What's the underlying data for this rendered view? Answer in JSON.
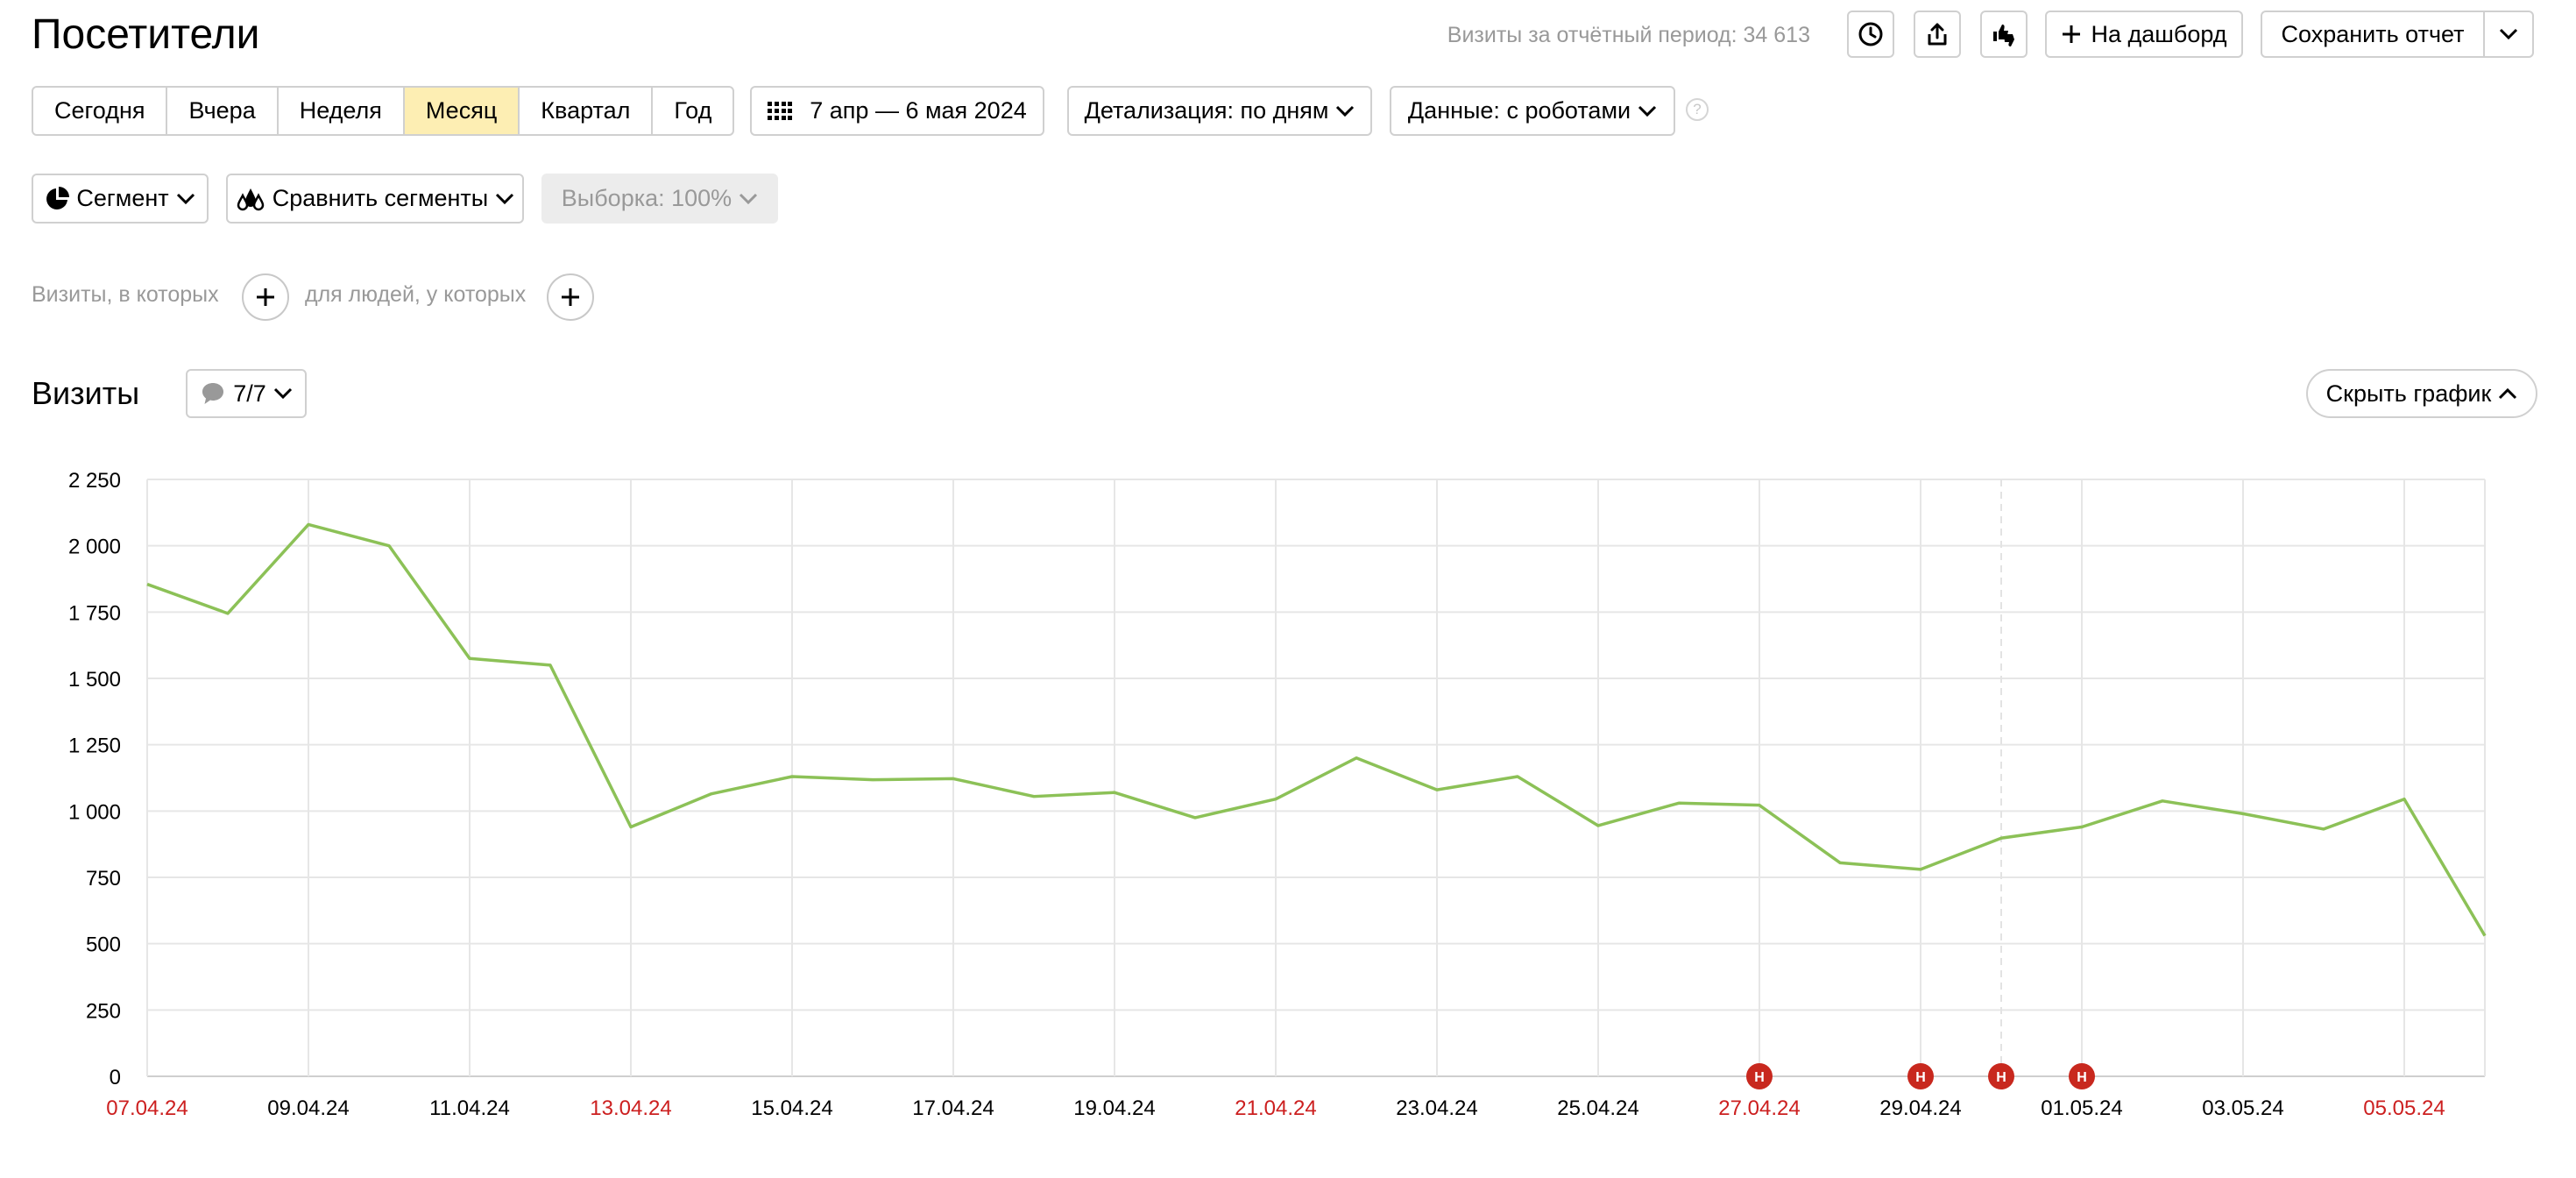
{
  "header": {
    "title": "Посетители",
    "total_visits": "Визиты за отчётный период: 34 613",
    "to_dashboard": "На дашборд",
    "save_report": "Сохранить отчет"
  },
  "period": {
    "presets": [
      "Сегодня",
      "Вчера",
      "Неделя",
      "Месяц",
      "Квартал",
      "Год"
    ],
    "active_index": 3,
    "date_range": "7 апр — 6 мая 2024",
    "detail": "Детализация: по дням",
    "data_mode": "Данные: с роботами"
  },
  "segments": {
    "segment": "Сегмент",
    "compare": "Сравнить сегменты",
    "sample": "Выборка: 100%"
  },
  "filters": {
    "visits_where": "Визиты, в которых",
    "people_where": "для людей, у которых"
  },
  "chart_section": {
    "title": "Визиты",
    "annotations": "7/7",
    "hide_chart": "Скрыть график"
  },
  "colors": {
    "line": "#8cc157",
    "weekend_label": "#cc1f1f",
    "holiday_marker": "#c8281e",
    "active_preset": "#fdeeb3"
  },
  "chart_data": {
    "type": "line",
    "ylim": [
      0,
      2250
    ],
    "y_ticks": [
      "0",
      "250",
      "500",
      "750",
      "1 000",
      "1 250",
      "1 500",
      "1 750",
      "2 000",
      "2 250"
    ],
    "x_labels": [
      {
        "text": "07.04.24",
        "weekend": true
      },
      {
        "text": "09.04.24",
        "weekend": false
      },
      {
        "text": "11.04.24",
        "weekend": false
      },
      {
        "text": "13.04.24",
        "weekend": true
      },
      {
        "text": "15.04.24",
        "weekend": false
      },
      {
        "text": "17.04.24",
        "weekend": false
      },
      {
        "text": "19.04.24",
        "weekend": false
      },
      {
        "text": "21.04.24",
        "weekend": true
      },
      {
        "text": "23.04.24",
        "weekend": false
      },
      {
        "text": "25.04.24",
        "weekend": false
      },
      {
        "text": "27.04.24",
        "weekend": true
      },
      {
        "text": "29.04.24",
        "weekend": false
      },
      {
        "text": "01.05.24",
        "weekend": false
      },
      {
        "text": "03.05.24",
        "weekend": false
      },
      {
        "text": "05.05.24",
        "weekend": true
      }
    ],
    "series": [
      {
        "values": [
          1855,
          1745,
          2080,
          2000,
          1575,
          1550,
          940,
          1065,
          1130,
          1118,
          1122,
          1055,
          1070,
          975,
          1045,
          1200,
          1080,
          1130,
          945,
          1030,
          1022,
          805,
          780,
          898,
          940,
          1038,
          990,
          932,
          1045,
          530
        ]
      }
    ],
    "holiday_markers": [
      {
        "day_index": 20,
        "label": "Н"
      },
      {
        "day_index": 22,
        "label": "Н"
      },
      {
        "day_index": 23,
        "label": "Н"
      },
      {
        "day_index": 24,
        "label": "Н"
      }
    ],
    "grid": true
  }
}
